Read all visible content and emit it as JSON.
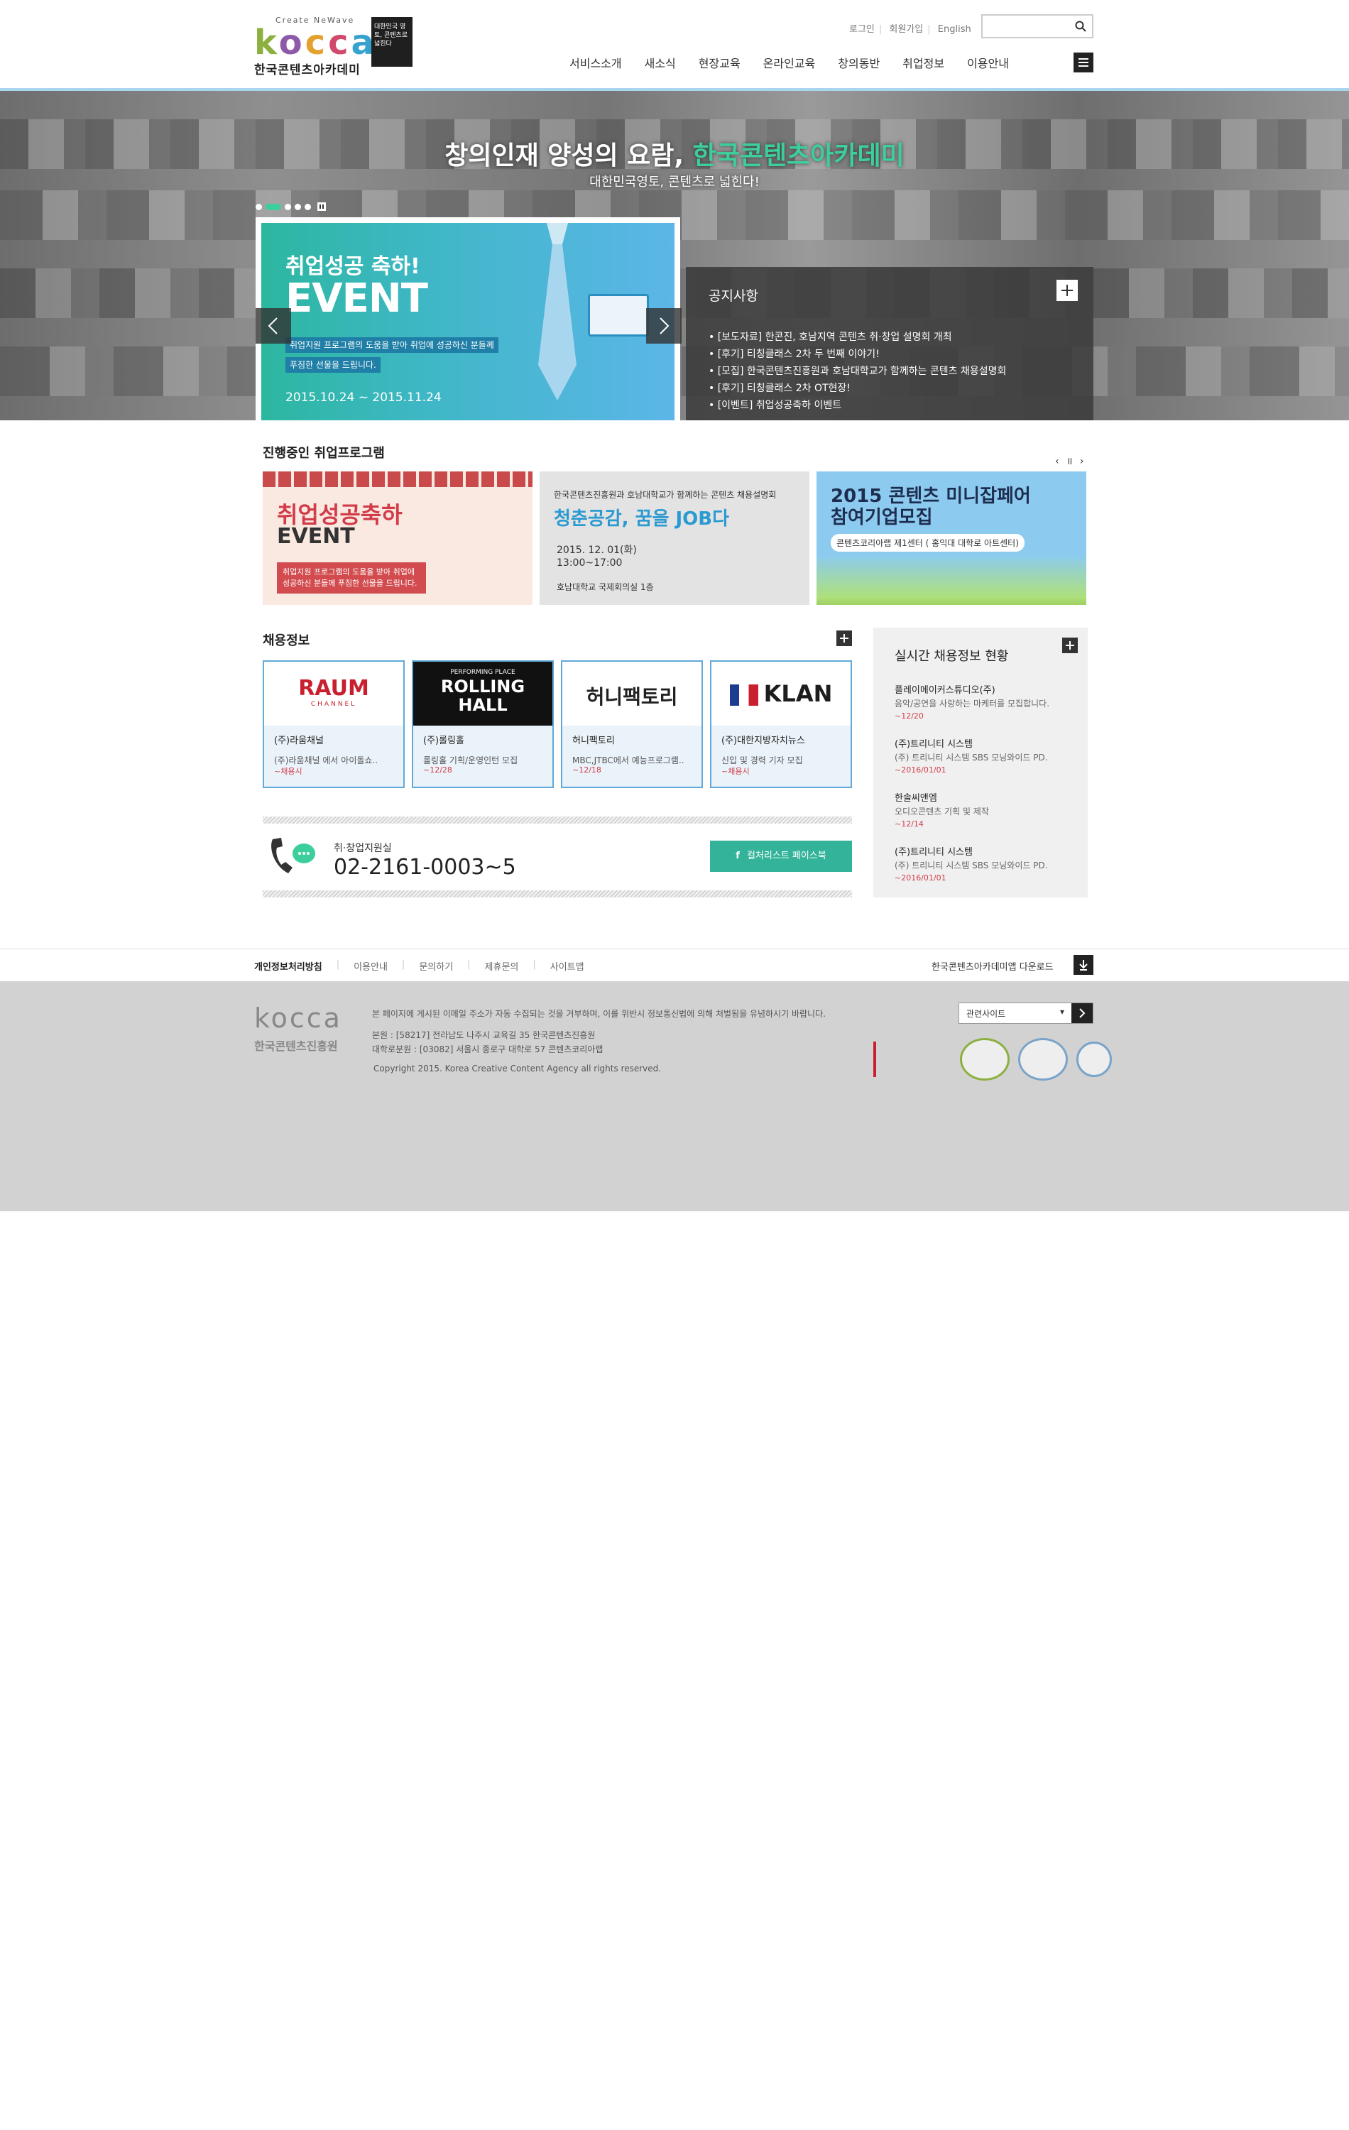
{
  "header": {
    "logo_tagline": "Create NeWave",
    "logo_letters": [
      "k",
      "o",
      "c",
      "c",
      "a"
    ],
    "logo_sub": "한국콘텐츠아카데미",
    "logo_badge": "대한민국 영토, 콘텐츠로 넓힌다",
    "utils": [
      "로그인",
      "회원가입",
      "English"
    ],
    "search_placeholder": "",
    "nav": [
      "서비스소개",
      "새소식",
      "현장교육",
      "온라인교육",
      "창의동반",
      "취업정보",
      "이용안내"
    ]
  },
  "hero": {
    "title_pre": "창의인재 양성의 요람, ",
    "title_accent": "한국콘텐츠아카데미",
    "subtitle": "대한민국영토, 콘텐츠로 넓힌다!",
    "event": {
      "line1": "취업성공 축하!",
      "line2": "EVENT",
      "desc1": "취업지원 프로그램의 도움을 받아 취업에 성공하신 분들께",
      "desc2": "푸짐한 선물을 드립니다.",
      "date": "2015.10.24 ~ 2015.11.24"
    },
    "notice": {
      "title": "공지사항",
      "items": [
        "[보도자료] 한콘진, 호남지역 콘텐츠 취·창업 설명회 개최",
        "[후기] 티칭클래스 2차 두 번째 이야기!",
        "[모집] 한국콘텐츠진흥원과 호남대학교가 함께하는 콘텐츠 채용설명회",
        "[후기] 티칭클래스 2차 OT현장!",
        "[이벤트] 취업성공축하 이벤트"
      ]
    }
  },
  "programs": {
    "title": "진행중인 취업프로그램",
    "cards": [
      {
        "t1": "취업성공축하",
        "t2": "EVENT",
        "desc": "취업지원 프로그램의 도움을 받아 취업에 성공하신 분들께 푸짐한 선물을 드립니다."
      },
      {
        "t0": "한국콘텐츠진흥원과 호남대학교가 함께하는 콘텐츠 채용설명회",
        "t1": "청춘공감, 꿈을 JOB다",
        "t2": "2015. 12. 01(화)\n13:00~17:00",
        "t3": "호남대학교 국제회의실 1층"
      },
      {
        "t1": "2015 콘텐츠 미니잡페어\n참여기업모집",
        "t3": "콘텐츠코리아랩 제1센터 ( 홍익대 대학로 아트센터)"
      }
    ]
  },
  "jobs": {
    "title": "채용정보",
    "cards": [
      {
        "logo": "RAUM",
        "logo_sub": "CHANNEL",
        "name": "(주)라움채널",
        "desc": "(주)라움채널 에서 아이돌쇼..",
        "date": "~채용시"
      },
      {
        "logo": "ROLLING HALL",
        "logo_sub": "PERFORMING PLACE",
        "name": "(주)롤링홀",
        "desc": "롤링홀 기획/운영인턴 모집",
        "date": "~12/28"
      },
      {
        "logo": "허니팩토리",
        "logo_sub": "",
        "name": "허니팩토리",
        "desc": "MBC,JTBC에서 예능프로그램..",
        "date": "~12/18"
      },
      {
        "logo": "KLAN",
        "logo_sub": "",
        "name": "(주)대한지방자치뉴스",
        "desc": "신입 및 경력 기자 모집",
        "date": "~채용시"
      }
    ],
    "contact_label": "취·창업지원실",
    "contact_number": "02-2161-0003~5",
    "facebook_label": "컬처리스트 페이스북"
  },
  "realtime": {
    "title": "실시간 채용정보 현황",
    "items": [
      {
        "company": "플레이메이커스튜디오(주)",
        "desc": "음악/공연을 사랑하는 마케터를 모집합니다.",
        "date": "~12/20"
      },
      {
        "company": "(주)트리니티 시스템",
        "desc": "(주) 트리니티 시스템 SBS 모닝와이드 PD.",
        "date": "~2016/01/01"
      },
      {
        "company": "한솔씨앤엠",
        "desc": "오디오콘텐츠 기획 및 제작",
        "date": "~12/14"
      },
      {
        "company": "(주)트리니티 시스템",
        "desc": "(주) 트리니티 시스템 SBS 모닝와이드 PD.",
        "date": "~2016/01/01"
      }
    ]
  },
  "footer": {
    "links": [
      "개인정보처리방침",
      "이용안내",
      "문의하기",
      "제휴문의",
      "사이트맵"
    ],
    "download": "한국콘텐츠아카데미앱 다운로드",
    "logo_text": "kocca",
    "logo_sub": "한국콘텐츠진흥원",
    "info1": "본 페이지에 게시된 이메일 주소가 자동 수집되는 것을 거부하며, 이를 위반시 정보통신법에 의해 처벌됨을 유념하시기 바랍니다.",
    "info2": "본원 : [58217] 전라남도 나주시 교육길 35 한국콘텐츠진흥원",
    "info3": "대학로분원 : [03082] 서울시 종로구 대학로 57 콘텐츠코리아랩",
    "copyright": "Copyright 2015. Korea Creative Content Agency all rights reserved.",
    "related_select": "관련사이트"
  },
  "colors": {
    "accent": "#3ccf9c",
    "blue": "#62a9d9",
    "red": "#d23b48"
  }
}
